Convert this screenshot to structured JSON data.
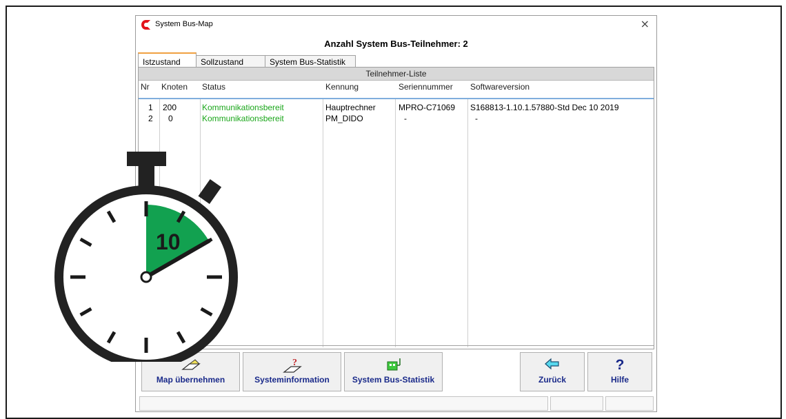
{
  "window": {
    "title": "System Bus-Map",
    "close_glyph": "×",
    "heading": "Anzahl System Bus-Teilnehmer: 2"
  },
  "tabs": [
    {
      "label": "Istzustand",
      "active": true
    },
    {
      "label": "Sollzustand",
      "active": false
    },
    {
      "label": "System Bus-Statistik",
      "active": false
    }
  ],
  "list": {
    "caption": "Teilnehmer-Liste",
    "columns": [
      "Nr",
      "Knoten",
      "Status",
      "Kennung",
      "Seriennummer",
      "Softwareversion"
    ],
    "rows": [
      {
        "nr": "1",
        "knoten": "200",
        "status": "Kommunikationsbereit",
        "kennung": "Hauptrechner",
        "serial": "MPRO-C71069",
        "software": "S168813-1.10.1.57880-Std Dec 10 2019"
      },
      {
        "nr": "2",
        "knoten": "0",
        "status": "Kommunikationsbereit",
        "kennung": "PM_DIDO",
        "serial": "-",
        "software": "-"
      }
    ],
    "status_color": "#1aa61a"
  },
  "buttons": {
    "map": {
      "label": "Map übernehmen",
      "icon": "map-accept-icon"
    },
    "sysinfo": {
      "label": "Systeminformation",
      "icon": "system-info-icon"
    },
    "stats": {
      "label": "System Bus-Statistik",
      "icon": "bus-statistics-icon"
    },
    "back": {
      "label": "Zurück",
      "icon": "arrow-left-icon"
    },
    "help": {
      "label": "Hilfe",
      "icon": "help-icon",
      "glyph": "?"
    }
  },
  "timer": {
    "value": "10",
    "icon": "stopwatch-icon",
    "accent": "#12a150"
  }
}
